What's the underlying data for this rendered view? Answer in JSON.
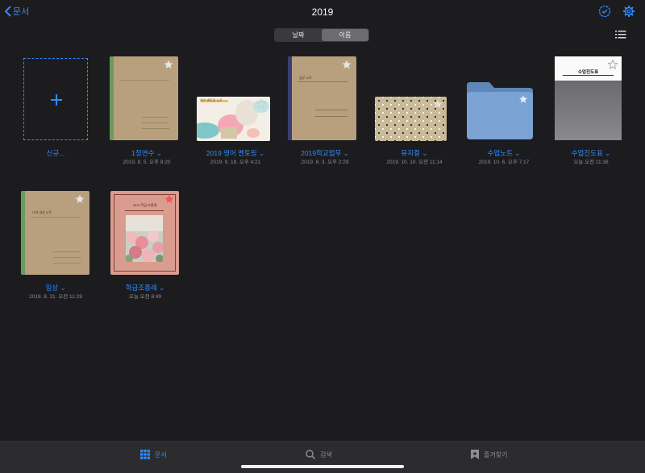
{
  "nav": {
    "back_label": "문서",
    "title": "2019"
  },
  "sort": {
    "options": [
      "날짜",
      "이름"
    ],
    "selected": "이름"
  },
  "new_item": {
    "label": "신규..."
  },
  "documents": [
    {
      "name": "1정연수",
      "date": "2019. 8. 5. 오후 8:20",
      "type": "notebook-kraft-green",
      "starred": false,
      "cover_title": ""
    },
    {
      "name": "2019 영어 멘토링",
      "date": "2019. 9. 18. 오후 4:21",
      "type": "notebook-art",
      "starred": false,
      "cover_title": "영어 멘토링 노트"
    },
    {
      "name": "2019학교업무",
      "date": "2019. 8. 3. 오후 2:29",
      "type": "notebook-kraft-navy",
      "starred": false,
      "cover_title": "업무 노트"
    },
    {
      "name": "뮤지컬",
      "date": "2019. 10. 10. 오전 11:14",
      "type": "notebook-dots",
      "starred": false,
      "cover_title": ""
    },
    {
      "name": "수업노트",
      "date": "2019. 10. 6. 오후 7:17",
      "type": "folder",
      "starred": false,
      "cover_title": ""
    },
    {
      "name": "수업진도표",
      "date": "오늘 오전 11:36",
      "type": "doc-gray",
      "starred": false,
      "cover_title": "수업진도표"
    },
    {
      "name": "일상",
      "date": "2019. 8. 21. 오전 11:29",
      "type": "notebook-kraft-green",
      "starred": false,
      "cover_title": "나의 일상 노트"
    },
    {
      "name": "학급조종례",
      "date": "오늘 오전 8:49",
      "type": "notebook-pink-photo",
      "starred": true,
      "cover_title": "2019 학급 조종례"
    }
  ],
  "tabs": [
    {
      "label": "문서",
      "icon": "grid-icon",
      "active": true
    },
    {
      "label": "검색",
      "icon": "search-icon",
      "active": false
    },
    {
      "label": "즐겨찾기",
      "icon": "bookmark-icon",
      "active": false
    }
  ],
  "colors": {
    "accent": "#2f8cff",
    "background": "#1c1c1e",
    "star_active": "#ff4f4f"
  }
}
